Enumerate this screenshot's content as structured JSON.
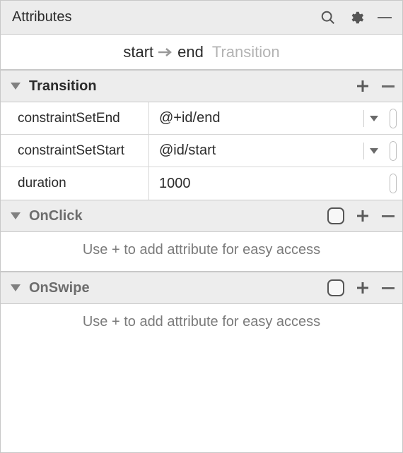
{
  "header": {
    "title": "Attributes"
  },
  "breadcrumb": {
    "start": "start",
    "end": "end",
    "type": "Transition"
  },
  "sections": {
    "transition": {
      "title": "Transition",
      "rows": [
        {
          "name": "constraintSetEnd",
          "value": "@+id/end",
          "hasDropdown": true
        },
        {
          "name": "constraintSetStart",
          "value": "@id/start",
          "hasDropdown": true
        },
        {
          "name": "duration",
          "value": "1000",
          "hasDropdown": false
        }
      ]
    },
    "onclick": {
      "title": "OnClick",
      "hint": "Use + to add attribute for easy access"
    },
    "onswipe": {
      "title": "OnSwipe",
      "hint": "Use + to add attribute for easy access"
    }
  }
}
